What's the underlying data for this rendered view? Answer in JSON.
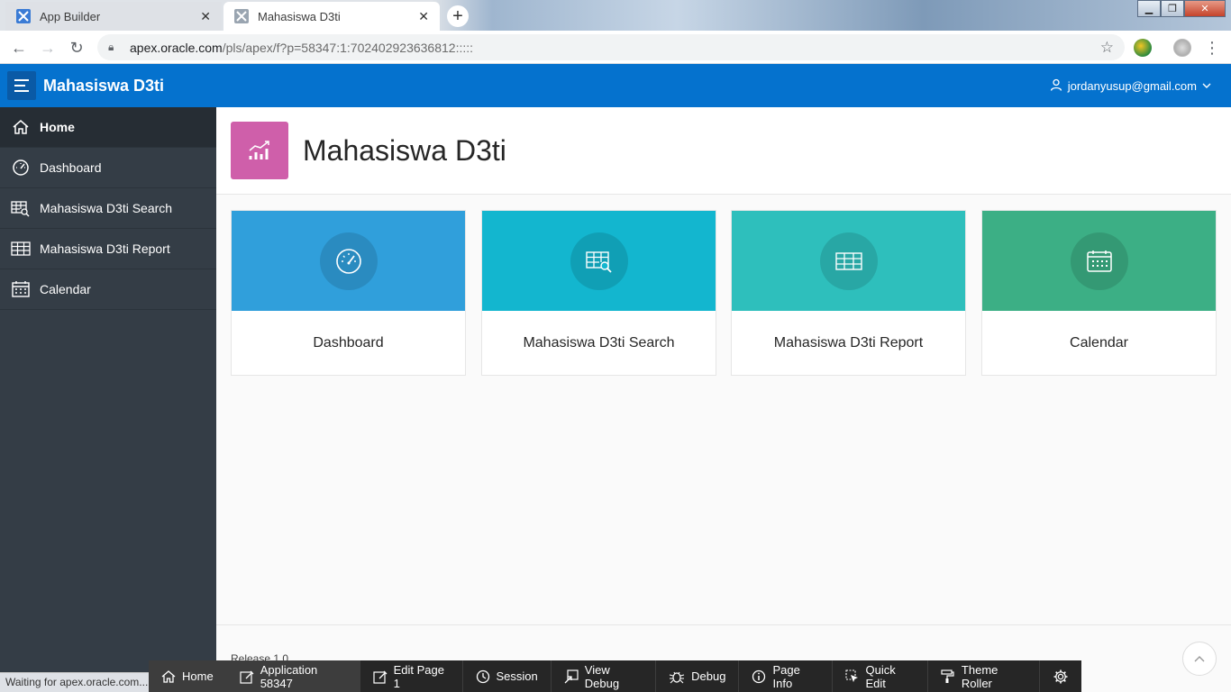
{
  "browser": {
    "tabs": [
      {
        "title": "App Builder",
        "active": false
      },
      {
        "title": "Mahasiswa D3ti",
        "active": true
      }
    ],
    "url_host": "apex.oracle.com",
    "url_path": "/pls/apex/f?p=58347:1:702402923636812:::::",
    "status_text": "Waiting for apex.oracle.com..."
  },
  "header": {
    "app_title": "Mahasiswa D3ti",
    "user": "jordanyusup@gmail.com"
  },
  "sidebar": {
    "items": [
      {
        "label": "Home",
        "icon": "home-icon",
        "active": true
      },
      {
        "label": "Dashboard",
        "icon": "dashboard-icon",
        "active": false
      },
      {
        "label": "Mahasiswa D3ti Search",
        "icon": "search-table-icon",
        "active": false
      },
      {
        "label": "Mahasiswa D3ti Report",
        "icon": "table-icon",
        "active": false
      },
      {
        "label": "Calendar",
        "icon": "calendar-icon",
        "active": false
      }
    ]
  },
  "hero": {
    "title": "Mahasiswa D3ti",
    "icon": "chart-icon",
    "icon_color": "#cf5faa"
  },
  "cards": [
    {
      "label": "Dashboard",
      "icon": "dashboard-icon",
      "color": "#309fdb"
    },
    {
      "label": "Mahasiswa D3ti Search",
      "icon": "search-table-icon",
      "color": "#13b6cf"
    },
    {
      "label": "Mahasiswa D3ti Report",
      "icon": "table-icon",
      "color": "#2ebfbc"
    },
    {
      "label": "Calendar",
      "icon": "calendar-icon",
      "color": "#3caf85"
    }
  ],
  "footer": {
    "release": "Release 1.0"
  },
  "dev_toolbar": {
    "items": [
      {
        "label": "Home",
        "icon": "home-icon"
      },
      {
        "label": "Application 58347",
        "icon": "edit-icon"
      },
      {
        "label": "Edit Page 1",
        "icon": "edit-icon"
      },
      {
        "label": "Session",
        "icon": "clock-icon"
      },
      {
        "label": "View Debug",
        "icon": "view-debug-icon"
      },
      {
        "label": "Debug",
        "icon": "bug-icon"
      },
      {
        "label": "Page Info",
        "icon": "info-icon"
      },
      {
        "label": "Quick Edit",
        "icon": "cursor-icon"
      },
      {
        "label": "Theme Roller",
        "icon": "paint-roller-icon"
      },
      {
        "label": "",
        "icon": "gear-icon"
      }
    ]
  },
  "colors": {
    "header_blue": "#0572ce",
    "sidebar_bg": "#343d46"
  }
}
